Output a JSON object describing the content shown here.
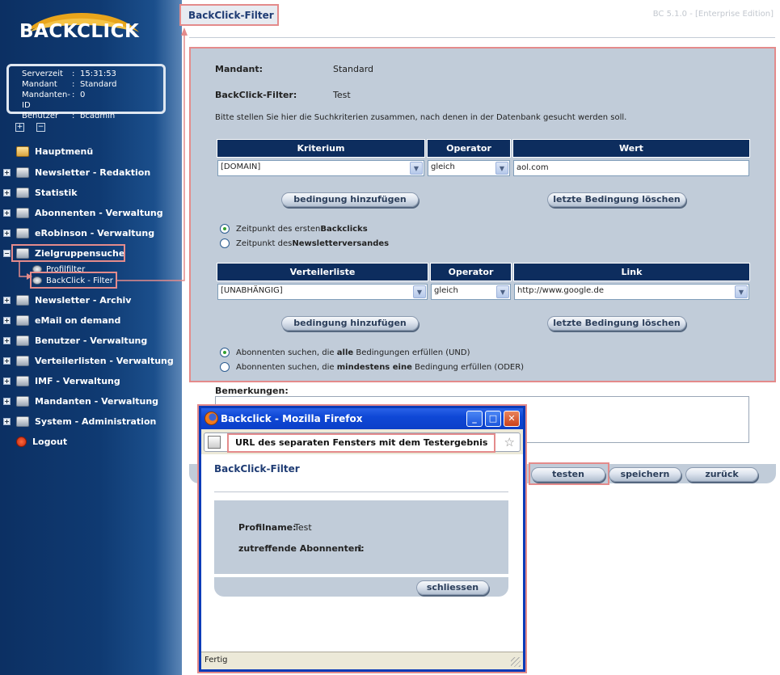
{
  "brand": {
    "logo_text": "BACKCLICK"
  },
  "server_info": [
    {
      "key": "Serverzeit",
      "value": "15:31:53"
    },
    {
      "key": "Mandant",
      "value": "Standard"
    },
    {
      "key": "Mandanten-ID",
      "value": "0"
    },
    {
      "key": "Benutzer",
      "value": "bcadmin"
    }
  ],
  "tree_toggles": {
    "expand": "+",
    "collapse": "−"
  },
  "nav": {
    "hauptmenue": "Hauptmenü",
    "newsletter_redaktion": "Newsletter - Redaktion",
    "statistik": "Statistik",
    "abonnenten": "Abonnenten - Verwaltung",
    "erobinson": "eRobinson - Verwaltung",
    "zielgruppensuche": "Zielgruppensuche",
    "profilfilter": "Profilfilter",
    "backclick_filter": "BackClick - Filter",
    "newsletter_archiv": "Newsletter - Archiv",
    "email_on_demand": "eMail on demand",
    "benutzer": "Benutzer - Verwaltung",
    "verteilerlisten": "Verteilerlisten - Verwaltung",
    "imf": "IMF - Verwaltung",
    "mandanten": "Mandanten - Verwaltung",
    "system": "System - Administration",
    "logout": "Logout"
  },
  "header": {
    "title": "BackClick-Filter",
    "version": "BC 5.1.0 - [Enterprise Edition]"
  },
  "form": {
    "mandant_label": "Mandant:",
    "mandant_value": "Standard",
    "filter_label": "BackClick-Filter:",
    "filter_value": "Test",
    "hint": "Bitte stellen Sie hier die Suchkriterien zusammen, nach denen in der Datenbank gesucht werden soll.",
    "criteria_table": {
      "headers": [
        "Kriterium",
        "Operator",
        "Wert"
      ],
      "kriterium": "[DOMAIN]",
      "operator": "gleich",
      "wert": "aol.com"
    },
    "btn_add": "bedingung hinzufügen",
    "btn_delete": "letzte Bedingung löschen",
    "radio_time": [
      {
        "pre": "Zeitpunkt des ersten ",
        "bold": "Backclicks",
        "post": ""
      },
      {
        "pre": "Zeitpunkt des ",
        "bold": "Newsletterversandes",
        "post": ""
      }
    ],
    "link_table": {
      "headers": [
        "Verteilerliste",
        "Operator",
        "Link"
      ],
      "verteilerliste": "[UNABHÄNGIG]",
      "operator": "gleich",
      "link": "http://www.google.de"
    },
    "radio_logic": [
      {
        "pre": "Abonnenten suchen, die ",
        "bold": "alle",
        "post": " Bedingungen erfüllen (UND)"
      },
      {
        "pre": "Abonnenten suchen, die ",
        "bold": "mindestens eine",
        "post": " Bedingung erfüllen (ODER)"
      }
    ],
    "remarks_label": "Bemerkungen:"
  },
  "actions": {
    "test": "testen",
    "save": "speichern",
    "back": "zurück"
  },
  "popup": {
    "window_title": "Backclick - Mozilla Firefox",
    "url_label": "URL des separaten Fensters mit dem Testergebnis",
    "heading": "BackClick-Filter",
    "profile_label": "Profilname:",
    "profile_value": "Test",
    "count_label": "zutreffende Abonnenten:",
    "count_value": "1",
    "close_button": "schliessen",
    "status": "Fertig"
  },
  "colors": {
    "sidebar": "#0f3a72",
    "panel": "#c1ccd9",
    "table_header": "#0d2d5e",
    "highlight": "#e48b8b"
  }
}
